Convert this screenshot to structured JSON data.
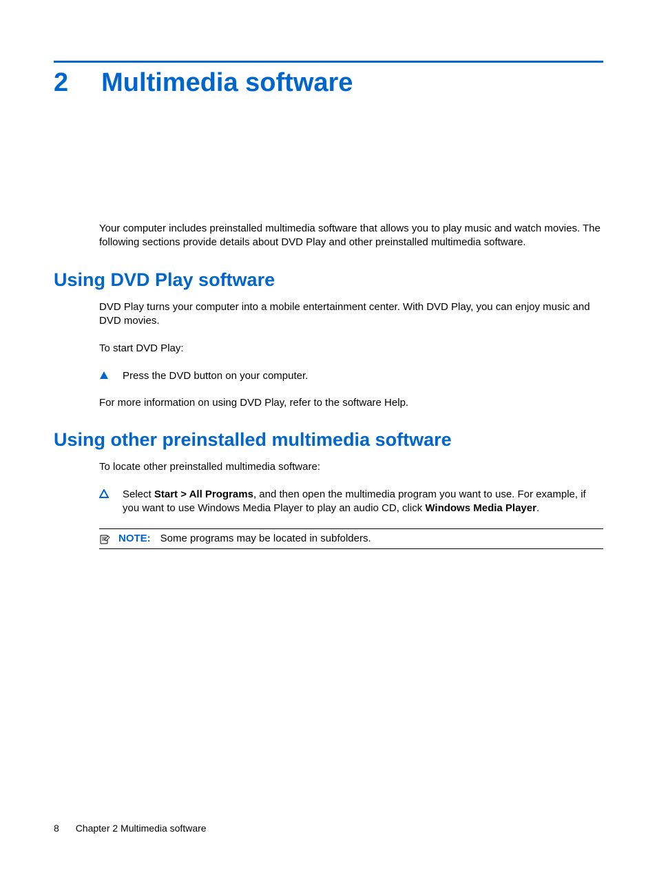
{
  "chapter": {
    "number": "2",
    "title": "Multimedia software"
  },
  "intro_text": "Your computer includes preinstalled multimedia software that allows you to play music and watch movies. The following sections provide details about DVD Play and other preinstalled multimedia software.",
  "section1": {
    "heading": "Using DVD Play software",
    "para1": "DVD Play turns your computer into a mobile entertainment center. With DVD Play, you can enjoy music and DVD movies.",
    "para2": "To start DVD Play:",
    "bullet1": "Press the DVD button on your computer.",
    "para3": "For more information on using DVD Play, refer to the software Help."
  },
  "section2": {
    "heading": "Using other preinstalled multimedia software",
    "para1": "To locate other preinstalled multimedia software:",
    "bullet1_pre": "Select ",
    "bullet1_bold1": "Start > All Programs",
    "bullet1_mid": ", and then open the multimedia program you want to use. For example, if you want to use Windows Media Player to play an audio CD, click ",
    "bullet1_bold2": "Windows Media Player",
    "bullet1_post": ".",
    "note_label": "NOTE:",
    "note_text": "Some programs may be located in subfolders."
  },
  "footer": {
    "page_number": "8",
    "chapter_label": "Chapter 2   Multimedia software"
  }
}
